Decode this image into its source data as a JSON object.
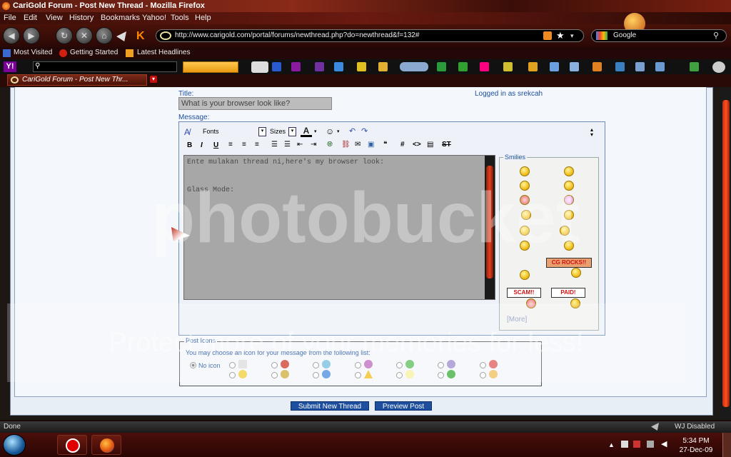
{
  "window": {
    "title": "CariGold Forum - Post New Thread - Mozilla Firefox"
  },
  "menu": [
    "File",
    "Edit",
    "View",
    "History",
    "Bookmarks",
    "Yahoo!",
    "Tools",
    "Help"
  ],
  "nav": {
    "url": "http://www.carigold.com/portal/forums/newthread.php?do=newthread&f=132#",
    "search_placeholder": "Google"
  },
  "bookmarks": [
    "Most Visited",
    "Getting Started",
    "Latest Headlines"
  ],
  "yahoo": {
    "search_value": ""
  },
  "tab": {
    "label": "CariGold Forum - Post New Thr..."
  },
  "form": {
    "title_label": "Title:",
    "title_value": "What is your browser look like?",
    "logged_in": "Logged in as srekcah",
    "message_label": "Message:",
    "fonts": "Fonts",
    "sizes": "Sizes",
    "message_text": "Ente mulakan thread ni,here's my browser look:\n\n\nGlass Mode:",
    "smilies_legend": "Smilies",
    "more": "[More]",
    "signs": [
      "CG ROCKS!!",
      "SCAM!!",
      "PAID!"
    ],
    "post_icons_legend": "Post Icons",
    "post_icons_desc": "You may choose an icon for your message from the following list:",
    "no_icon": "No icon",
    "submit": "Submit New Thread",
    "preview": "Preview Post"
  },
  "status": {
    "left": "Done",
    "right": "WJ Disabled"
  },
  "clock": {
    "time": "5:34 PM",
    "date": "27-Dec-09"
  },
  "watermark": {
    "main": "photobucket",
    "sub": "Protect more of your memories for less!"
  },
  "colors": {
    "accent": "#1d4f9e",
    "chrome": "#6a1a10",
    "link": "#1c4e9c"
  }
}
